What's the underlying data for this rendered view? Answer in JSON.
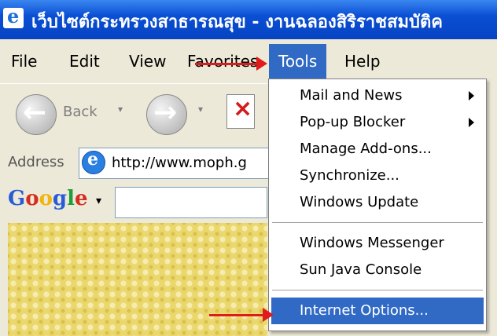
{
  "window": {
    "title": "เว็บไซต์กระทรวงสาธารณสุข - งานฉลองสิริราชสมบัติค"
  },
  "menubar": {
    "items": [
      "File",
      "Edit",
      "View",
      "Favorites",
      "Tools",
      "Help"
    ]
  },
  "toolbar": {
    "back_label": "Back"
  },
  "address": {
    "label": "Address",
    "url": "http://www.moph.g"
  },
  "google": {
    "logo": "Google"
  },
  "tools_menu": {
    "items": [
      {
        "label": "Mail and News",
        "submenu": true
      },
      {
        "label": "Pop-up Blocker",
        "submenu": true
      },
      {
        "label": "Manage Add-ons...",
        "submenu": false
      },
      {
        "label": "Synchronize...",
        "submenu": false
      },
      {
        "label": "Windows Update",
        "submenu": false
      },
      {
        "label": "Windows Messenger",
        "submenu": false
      },
      {
        "label": "Sun Java Console",
        "submenu": false
      },
      {
        "label": "Internet Options...",
        "submenu": false,
        "highlighted": true
      }
    ]
  },
  "colors": {
    "highlight": "#316ac5",
    "annotation_arrow": "#e01b1b",
    "titlebar": "#0a4fd4"
  }
}
